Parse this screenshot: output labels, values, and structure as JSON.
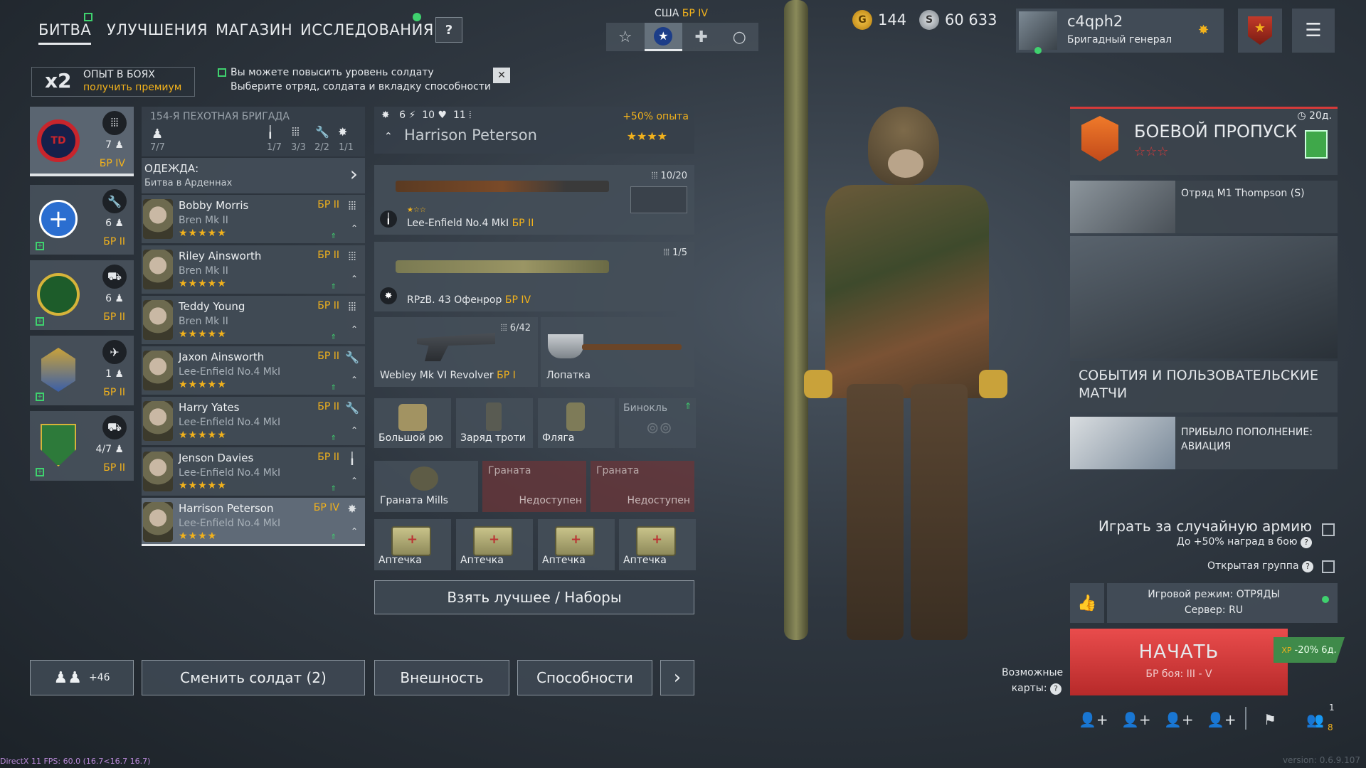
{
  "nav": {
    "tabs": [
      "БИТВА",
      "УЛУЧШЕНИЯ",
      "МАГАЗИН",
      "ИССЛЕДОВАНИЯ"
    ],
    "help_label": "?"
  },
  "nation": {
    "name": "США",
    "br": "БР IV"
  },
  "currency": {
    "gold": "144",
    "silver": "60 633"
  },
  "profile": {
    "name": "c4qph2",
    "rank": "Бригадный генерал"
  },
  "xp_bonus": {
    "multiplier": "x2",
    "title": "ОПЫТ В БОЯХ",
    "link": "получить премиум"
  },
  "notice": {
    "line1": "Вы можете повысить уровень солдату",
    "line2": "Выберите отряд, солдата и вкладку способности",
    "close": "✕"
  },
  "squads": [
    {
      "count": "7",
      "br": "БР IV",
      "icon": "ammo-icon"
    },
    {
      "count": "6",
      "br": "БР II",
      "icon": "wrench-icon"
    },
    {
      "count": "6",
      "br": "БР II",
      "icon": "vehicle-icon"
    },
    {
      "count": "1",
      "br": "БР II",
      "icon": "plane-icon"
    },
    {
      "count": "4/7",
      "br": "БР II",
      "icon": "tank-icon"
    }
  ],
  "squad_info": {
    "title": "154-Я ПЕХОТНАЯ БРИГАДА",
    "members": "7/7",
    "slots": [
      "1/7",
      "3/3",
      "2/2",
      "1/1"
    ],
    "outfit_title": "ОДЕЖДА:",
    "outfit_value": "Битва в Арденнах"
  },
  "soldiers": [
    {
      "name": "Bobby Morris",
      "weapon": "Bren Mk II",
      "br": "БР II",
      "stars": "★★★★★"
    },
    {
      "name": "Riley Ainsworth",
      "weapon": "Bren Mk II",
      "br": "БР II",
      "stars": "★★★★★"
    },
    {
      "name": "Teddy Young",
      "weapon": "Bren Mk II",
      "br": "БР II",
      "stars": "★★★★★"
    },
    {
      "name": "Jaxon Ainsworth",
      "weapon": "Lee-Enfield No.4 MkI",
      "br": "БР II",
      "stars": "★★★★★"
    },
    {
      "name": "Harry Yates",
      "weapon": "Lee-Enfield No.4 MkI",
      "br": "БР II",
      "stars": "★★★★★"
    },
    {
      "name": "Jenson Davies",
      "weapon": "Lee-Enfield No.4 MkI",
      "br": "БР II",
      "stars": "★★★★★"
    },
    {
      "name": "Harrison Peterson",
      "weapon": "Lee-Enfield No.4 MkI",
      "br": "БР IV",
      "stars": "★★★★"
    }
  ],
  "selected": {
    "stat1": "6",
    "stat2": "10",
    "stat3": "11",
    "xp_bonus": "+50% опыта",
    "name": "Harrison Peterson",
    "stars": "★★★★"
  },
  "equipment": {
    "primary": {
      "name": "Lee-Enfield No.4 MkI",
      "br": "БР II",
      "ammo": "10/20"
    },
    "secondary": {
      "name": "RPzB. 43 Офенрор",
      "br": "БР IV",
      "ammo": "1/5"
    },
    "sidearm": {
      "name": "Webley Mk VI Revolver",
      "br": "БР I",
      "ammo": "6/42"
    },
    "melee": {
      "name": "Лопатка"
    },
    "small": [
      "Большой рю",
      "Заряд трoти",
      "Фляга",
      "Бинокль"
    ],
    "grenades": [
      {
        "name": "Граната Mills",
        "status": ""
      },
      {
        "name": "Граната",
        "status": "Недоступен"
      },
      {
        "name": "Граната",
        "status": "Недоступен"
      }
    ],
    "medkits": [
      "Аптечка",
      "Аптечка",
      "Аптечка",
      "Аптечка"
    ]
  },
  "buttons": {
    "best": "Взять лучшее / Наборы",
    "reserve": "+46",
    "change": "Сменить солдат (2)",
    "appearance": "Внешность",
    "abilities": "Способности",
    "more": "›"
  },
  "battle_pass": {
    "title": "БОЕВОЙ ПРОПУСК",
    "days": "20д.",
    "stars": "☆☆☆"
  },
  "events": [
    {
      "title": "Отряд M1 Thompson (S)"
    },
    {
      "title": "СОБЫТИЯ И ПОЛЬЗОВАТЕЛЬСКИЕ МАТЧИ"
    },
    {
      "title": "ПРИБЫЛО ПОПОЛНЕНИЕ: АВИАЦИЯ"
    }
  ],
  "options": {
    "random_army": "Играть за случайную армию",
    "random_army_sub": "До +50% наград в бою",
    "open_group": "Открытая группа"
  },
  "game_mode": {
    "mode": "Игровой режим: ОТРЯДЫ",
    "server": "Сервер: RU"
  },
  "start": {
    "label": "НАЧАТЬ",
    "sub": "БР боя: III - V",
    "discount": "-20% 6д."
  },
  "maps_label_1": "Возможные",
  "maps_label_2": "карты:",
  "party": {
    "count_top": "1",
    "count_bottom": "8"
  },
  "debug": "DirectX 11 FPS: 60.0 (16.7<16.7 16.7)",
  "version": "version: 0.6.9.107",
  "colors": {
    "accent": "#f2b21c",
    "start": "#d63a3a",
    "ok": "#3fd16e"
  }
}
